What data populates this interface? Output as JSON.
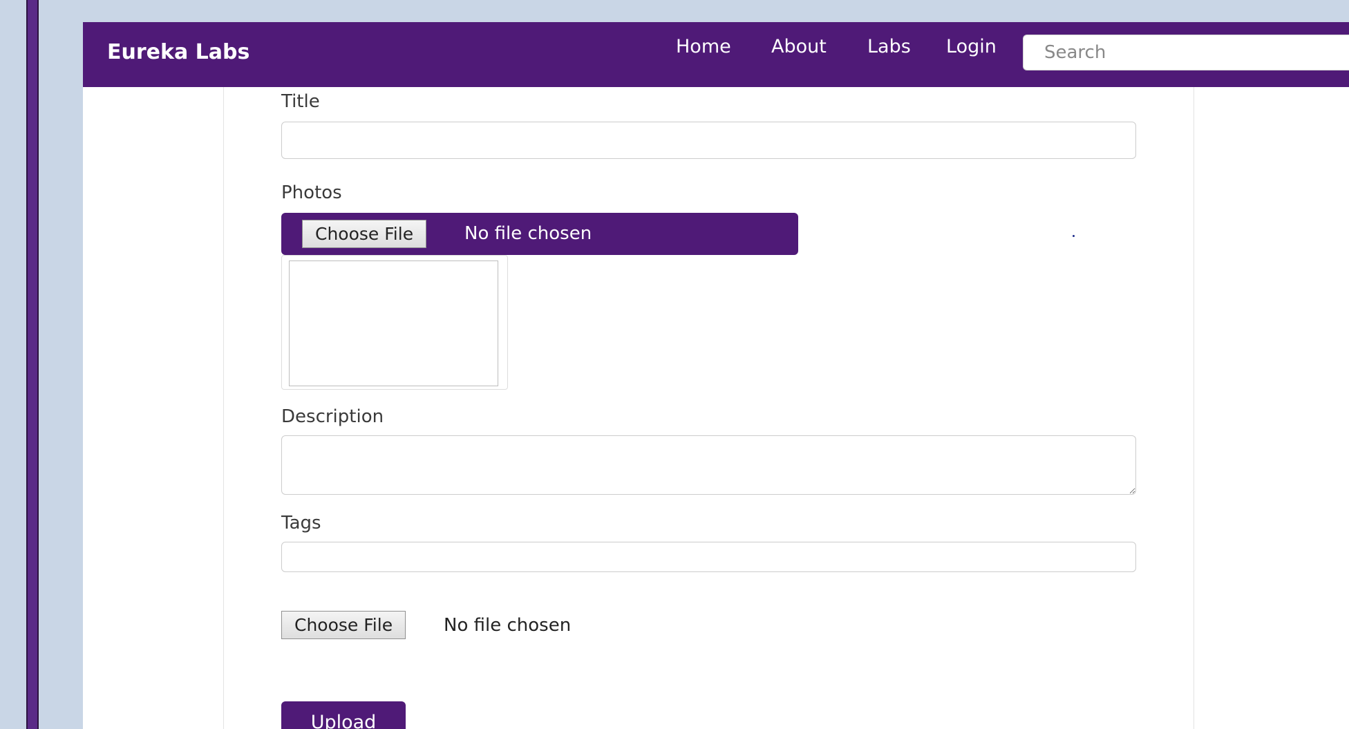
{
  "nav": {
    "brand": "Eureka Labs",
    "links": [
      "Home",
      "About",
      "Labs",
      "Login"
    ],
    "search_placeholder": "Search"
  },
  "form": {
    "title_label": "Title",
    "title_value": "",
    "photos_label": "Photos",
    "photos_button": "Choose File",
    "photos_status": "No file chosen",
    "description_label": "Description",
    "description_value": "",
    "tags_label": "Tags",
    "tags_value": "",
    "file_button": "Choose File",
    "file_status": "No file chosen",
    "upload_label": "Upload"
  },
  "colors": {
    "brand_purple": "#4f1a77",
    "desktop_bg": "#c9d6e6"
  }
}
